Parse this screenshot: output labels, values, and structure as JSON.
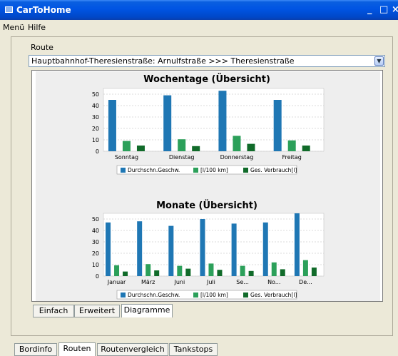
{
  "window": {
    "title": "CarToHome",
    "minimize": "_",
    "maximize": "□",
    "close": "×"
  },
  "menu": {
    "items": [
      "Menü",
      "Hilfe"
    ]
  },
  "route": {
    "label": "Route",
    "selected": "Hauptbahnhof-Theresienstraße: Arnulfstraße >>> Theresienstraße"
  },
  "subtabs": [
    "Einfach",
    "Erweitert",
    "Diagramme"
  ],
  "active_subtab": "Diagramme",
  "bottom_tabs": [
    "Bordinfo",
    "Routen",
    "Routenvergleich",
    "Tankstops"
  ],
  "active_bottom_tab": "Routen",
  "chart_data": [
    {
      "type": "bar",
      "title": "Wochentage (Übersicht)",
      "categories": [
        "Sonntag",
        "Dienstag",
        "Donnerstag",
        "Freitag"
      ],
      "ylim": [
        0,
        55
      ],
      "yticks": [
        0,
        10,
        20,
        30,
        40,
        50
      ],
      "series": [
        {
          "name": "Durchschn.Geschw.",
          "color": "#1f77b4",
          "values": [
            45,
            49,
            53,
            45
          ]
        },
        {
          "name": "[l/100 km]",
          "color": "#2ca05a",
          "values": [
            9,
            10.5,
            13.5,
            9.5
          ]
        },
        {
          "name": "Ges. Verbrauch[l]",
          "color": "#116b2a",
          "values": [
            5,
            4.5,
            6.5,
            5
          ]
        }
      ],
      "grid": true,
      "legend": "bottom"
    },
    {
      "type": "bar",
      "title": "Monate (Übersicht)",
      "categories": [
        "Januar",
        "März",
        "Juni",
        "Juli",
        "Se...",
        "No...",
        "De..."
      ],
      "ylim": [
        0,
        55
      ],
      "yticks": [
        0,
        10,
        20,
        30,
        40,
        50
      ],
      "series": [
        {
          "name": "Durchschn.Geschw.",
          "color": "#1f77b4",
          "values": [
            47,
            48,
            44,
            50,
            46,
            47,
            55
          ]
        },
        {
          "name": "[l/100 km]",
          "color": "#2ca05a",
          "values": [
            9.5,
            10.5,
            9,
            11,
            9,
            12,
            14
          ]
        },
        {
          "name": "Ges. Verbrauch[l]",
          "color": "#116b2a",
          "values": [
            4,
            5,
            6.5,
            5.5,
            4.5,
            6,
            7.5
          ]
        }
      ],
      "grid": true,
      "legend": "bottom"
    }
  ]
}
